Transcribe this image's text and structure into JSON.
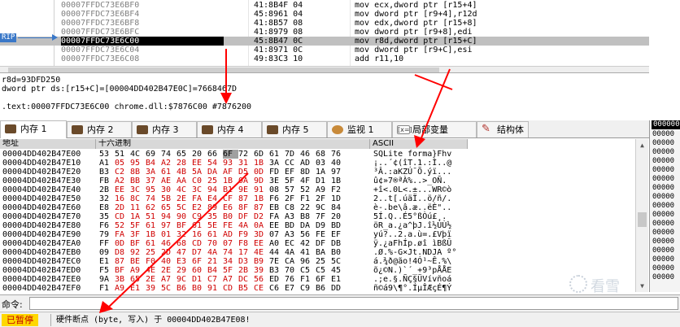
{
  "disasm": {
    "rip_label": "RIP",
    "rows": [
      {
        "addr": "00007FFDC73E6BF0",
        "bytes": "41:8B4F 04",
        "inst": "mov ecx,dword ptr [r15+4]"
      },
      {
        "addr": "00007FFDC73E6BF4",
        "bytes": "45:8961 04",
        "inst": "mov dword ptr [r9+4],r12d"
      },
      {
        "addr": "00007FFDC73E6BF8",
        "bytes": "41:8B57 08",
        "inst": "mov edx,dword ptr [r15+8]"
      },
      {
        "addr": "00007FFDC73E6BFC",
        "bytes": "41:8979 08",
        "inst": "mov dword ptr [r9+8],edi"
      },
      {
        "addr": "00007FFDC73E6C00",
        "bytes": "45:8B47 0C",
        "inst": "mov r8d,dword ptr [r15+C]"
      },
      {
        "addr": "00007FFDC73E6C04",
        "bytes": "41:8971 0C",
        "inst": "mov dword ptr [r9+C],esi"
      },
      {
        "addr": "00007FFDC73E6C08",
        "bytes": "49:83C3 10",
        "inst": "add r11,10"
      }
    ]
  },
  "info": {
    "line1": "r8d=93DFD250",
    "line2": "dword ptr ds:[r15+C]=[00004DD402B47E0C]=7668467D",
    "line3": "",
    "line4": ".text:00007FFDC73E6C00 chrome.dll:$7876C00 #7876200"
  },
  "tabs": [
    {
      "label": "内存 1",
      "icon": "memory-icon"
    },
    {
      "label": "内存 2",
      "icon": "memory-icon"
    },
    {
      "label": "内存 3",
      "icon": "memory-icon"
    },
    {
      "label": "内存 4",
      "icon": "memory-icon"
    },
    {
      "label": "内存 5",
      "icon": "memory-icon"
    },
    {
      "label": "监视 1",
      "icon": "watch-icon"
    },
    {
      "label": "局部变量",
      "icon": "locals-icon",
      "icon_text": "[x=]"
    },
    {
      "label": "结构体",
      "icon": "struct-icon"
    }
  ],
  "dump": {
    "headers": {
      "address": "地址",
      "hex": "十六进制",
      "ascii": "ASCII"
    },
    "rows": [
      {
        "a": "00004DD402B47E00",
        "h": [
          "53",
          "51",
          "4C",
          "69",
          "74",
          "65",
          "20",
          "66",
          "6F",
          "72",
          "6D",
          "61",
          "7D",
          "46",
          "68",
          "76"
        ],
        "s": "SQLite forma}Fhv"
      },
      {
        "a": "00004DD402B47E10",
        "h": [
          "A1",
          "05",
          "95",
          "B4",
          "A2",
          "28",
          "EE",
          "54",
          "93",
          "31",
          "1B",
          "3A",
          "CC",
          "AD",
          "03",
          "40"
        ],
        "s": "¡..´¢(îT.1.:Ì..@"
      },
      {
        "a": "00004DD402B47E20",
        "h": [
          "B3",
          "C2",
          "8B",
          "3A",
          "61",
          "4B",
          "5A",
          "DA",
          "AF",
          "D5",
          "0D",
          "FD",
          "EF",
          "8D",
          "1A",
          "97"
        ],
        "s": "³Â.:aKZÚ¯Õ.ýï..."
      },
      {
        "a": "00004DD402B47E30",
        "h": [
          "FB",
          "A2",
          "BB",
          "37",
          "AE",
          "AA",
          "C0",
          "25",
          "1B",
          "0A",
          "9D",
          "3E",
          "5F",
          "4F",
          "D1",
          "1B"
        ],
        "s": "û¢»7®ªÀ%..>_OÑ."
      },
      {
        "a": "00004DD402B47E40",
        "h": [
          "2B",
          "EE",
          "3C",
          "95",
          "30",
          "4C",
          "3C",
          "94",
          "B1",
          "9E",
          "91",
          "08",
          "57",
          "52",
          "A9",
          "F2"
        ],
        "s": "+î<.0L<.±...WR©ò"
      },
      {
        "a": "00004DD402B47E50",
        "h": [
          "32",
          "16",
          "8C",
          "74",
          "5B",
          "2E",
          "FA",
          "E4",
          "CF",
          "87",
          "1B",
          "F6",
          "2F",
          "F1",
          "2F",
          "1D"
        ],
        "s": "2..t[.úäÏ..ö/ñ/."
      },
      {
        "a": "00004DD402B47E60",
        "h": [
          "E8",
          "2D",
          "11",
          "62",
          "65",
          "5C",
          "E2",
          "89",
          "E6",
          "8F",
          "87",
          "EB",
          "C8",
          "22",
          "9C",
          "84"
        ],
        "s": "è-.be\\â.æ..ëÈ\".."
      },
      {
        "a": "00004DD402B47E70",
        "h": [
          "35",
          "CD",
          "1A",
          "51",
          "94",
          "90",
          "C9",
          "35",
          "B0",
          "DF",
          "D2",
          "FA",
          "A3",
          "B8",
          "7F",
          "20"
        ],
        "s": "5Í.Q..É5°ßÒú£¸. "
      },
      {
        "a": "00004DD402B47E80",
        "h": [
          "F6",
          "52",
          "5F",
          "61",
          "97",
          "BF",
          "61",
          "5E",
          "FE",
          "4A",
          "0A",
          "EE",
          "BD",
          "DA",
          "D9",
          "BD"
        ],
        "s": "öR_a.¿a^þJ.î½ÚÙ½"
      },
      {
        "a": "00004DD402B47E90",
        "h": [
          "79",
          "FA",
          "3F",
          "1B",
          "01",
          "32",
          "16",
          "61",
          "AD",
          "F9",
          "3D",
          "07",
          "A3",
          "56",
          "FE",
          "EF"
        ],
        "s": "yú?..2.a.ù=.£Vþï"
      },
      {
        "a": "00004DD402B47EA0",
        "h": [
          "FF",
          "0D",
          "BF",
          "61",
          "46",
          "68",
          "CD",
          "70",
          "07",
          "F8",
          "EE",
          "A0",
          "EC",
          "42",
          "DF",
          "DB"
        ],
        "s": "ÿ.¿aFhÍp.øî ìBßÛ"
      },
      {
        "a": "00004DD402B47EB0",
        "h": [
          "09",
          "D8",
          "92",
          "25",
          "2D",
          "47",
          "D7",
          "4A",
          "74",
          "17",
          "4E",
          "44",
          "4A",
          "41",
          "BA",
          "B0"
        ],
        "s": ".Ø.%-G×Jt.NDJA º°"
      },
      {
        "a": "00004DD402B47EC0",
        "h": [
          "E1",
          "87",
          "BE",
          "F0",
          "40",
          "E3",
          "6F",
          "21",
          "34",
          "D3",
          "B9",
          "7E",
          "CA",
          "96",
          "25",
          "5C"
        ],
        "s": "á.¾ð@ão!4Ó¹~Ê.%\\"
      },
      {
        "a": "00004DD402B47ED0",
        "h": [
          "F5",
          "BF",
          "A9",
          "4E",
          "2E",
          "29",
          "60",
          "B4",
          "5F",
          "2B",
          "39",
          "B3",
          "70",
          "C5",
          "C5",
          "45"
        ],
        "s": "õ¿©N.)`´_+9³pÅÅE"
      },
      {
        "a": "00004DD402B47EE0",
        "h": [
          "9A",
          "3B",
          "65",
          "2E",
          "A7",
          "9C",
          "D1",
          "C7",
          "A7",
          "DC",
          "56",
          "ED",
          "76",
          "F1",
          "6F",
          "E1"
        ],
        "s": ".;e.§.ÑÇ§ÜVívñoá"
      },
      {
        "a": "00004DD402B47EF0",
        "h": [
          "F1",
          "A9",
          "E1",
          "39",
          "5C",
          "B6",
          "B0",
          "91",
          "CD",
          "B5",
          "CE",
          "C6",
          "E7",
          "C9",
          "B6",
          "DD"
        ],
        "s": "ñ©á9\\¶°.ÍµÎÆçÉ¶Ý"
      }
    ]
  },
  "stack": {
    "head": "000000",
    "rows": [
      "00000",
      "00000",
      "00000",
      "00000",
      "00000",
      "00000",
      "00000",
      "00000",
      "00000",
      "00000",
      "00000",
      "00000",
      "00000",
      "00000",
      "00000",
      "00000",
      "00000"
    ]
  },
  "command": {
    "label": "命令:",
    "value": ""
  },
  "status": {
    "state": "已暂停",
    "message": "硬件断点 (byte, 写入) 于 00004DD402B47E08!"
  },
  "watermark": "看雪",
  "colors": {
    "accent": "#3a78c8",
    "annotation_arrow": "#ff0000",
    "paused_bg": "#ffd800",
    "paused_fg": "#c00000"
  }
}
